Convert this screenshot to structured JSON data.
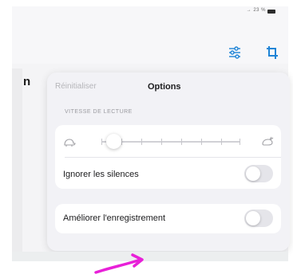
{
  "status_bar": {
    "text": "→ 23 %"
  },
  "toolbar": {
    "filter_icon": "sliders-icon",
    "crop_icon": "crop-icon"
  },
  "popover": {
    "reset_label": "Réinitialiser",
    "title": "Options",
    "speed_section_label": "VITESSE DE LECTURE",
    "speed": {
      "slow_icon": "turtle-icon",
      "fast_icon": "rabbit-icon",
      "value_fraction": 0.14
    },
    "skip_silence": {
      "label": "Ignorer les silences",
      "enabled": false
    },
    "enhance_recording": {
      "label": "Améliorer l'enregistrement",
      "enabled": false
    }
  },
  "colors": {
    "accent": "#1e84d6",
    "arrow": "#e820d8",
    "toggle_off": "#e5e5ea"
  }
}
